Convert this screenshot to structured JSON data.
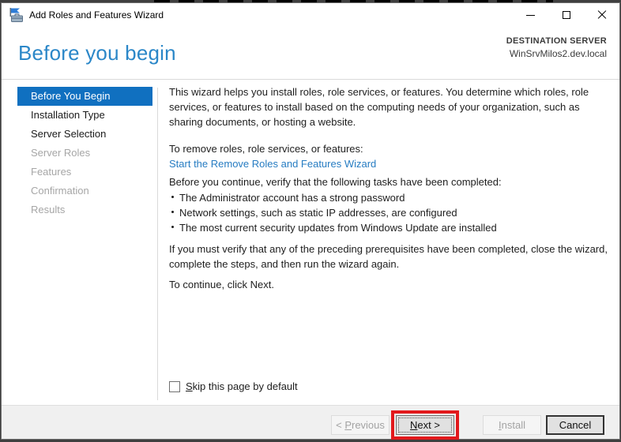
{
  "colors": {
    "nav-selected": "#1070c0",
    "heading": "#2b87c8",
    "link": "#267cc2",
    "annotation": "#e2191c",
    "titlebar-bg": "#ffffff",
    "footer-bg": "#f0f0f0",
    "frame-dark": "#3f3f3f"
  },
  "window": {
    "title": "Add Roles and Features Wizard"
  },
  "header": {
    "title": "Before you begin",
    "destination_label": "DESTINATION SERVER",
    "destination_server": "WinSrvMilos2.dev.local"
  },
  "sidebar": {
    "items": [
      {
        "label": "Before You Begin",
        "state": "selected"
      },
      {
        "label": "Installation Type",
        "state": "enabled"
      },
      {
        "label": "Server Selection",
        "state": "enabled"
      },
      {
        "label": "Server Roles",
        "state": "disabled"
      },
      {
        "label": "Features",
        "state": "disabled"
      },
      {
        "label": "Confirmation",
        "state": "disabled"
      },
      {
        "label": "Results",
        "state": "disabled"
      }
    ]
  },
  "content": {
    "intro": "This wizard helps you install roles, role services, or features. You determine which roles, role services, or features to install based on the computing needs of your organization, such as sharing documents, or hosting a website.",
    "remove_intro": "To remove roles, role services, or features:",
    "remove_link": "Start the Remove Roles and Features Wizard",
    "verify_intro": "Before you continue, verify that the following tasks have been completed:",
    "bullets": [
      "The Administrator account has a strong password",
      "Network settings, such as static IP addresses, are configured",
      "The most current security updates from Windows Update are installed"
    ],
    "prereq_note": "If you must verify that any of the preceding prerequisites have been completed, close the wizard, complete the steps, and then run the wizard again.",
    "continue_note": "To continue, click Next.",
    "skip_checkbox": {
      "accel": "S",
      "rest": "kip this page by default",
      "checked": "unchecked"
    }
  },
  "footer": {
    "previous": {
      "prefix": "< ",
      "accel": "P",
      "rest": "revious"
    },
    "next": {
      "accel": "N",
      "rest": "ext >"
    },
    "install": {
      "accel": "I",
      "rest": "nstall"
    },
    "cancel": {
      "label": "Cancel"
    }
  }
}
